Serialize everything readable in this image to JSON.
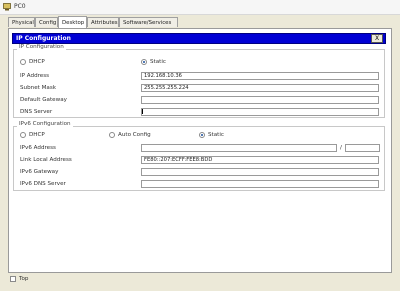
{
  "window": {
    "title": "PC0"
  },
  "tabs": [
    "Physical",
    "Config",
    "Desktop",
    "Attributes",
    "Software/Services"
  ],
  "ip_config": {
    "title": "IP Configuration",
    "close_label": "X",
    "ipv4": {
      "section_label": "IP Configuration",
      "dhcp_label": "DHCP",
      "static_label": "Static",
      "mode": "Static",
      "ip_address_label": "IP Address",
      "ip_address": "192.168.10.36",
      "subnet_mask_label": "Subnet Mask",
      "subnet_mask": "255.255.255.224",
      "default_gateway_label": "Default Gateway",
      "default_gateway": "",
      "dns_server_label": "DNS Server",
      "dns_server": ""
    },
    "ipv6": {
      "section_label": "IPv6 Configuration",
      "dhcp_label": "DHCP",
      "auto_config_label": "Auto Config",
      "static_label": "Static",
      "mode": "Static",
      "address_label": "IPv6 Address",
      "address": "",
      "prefix_separator": "/",
      "prefix": "",
      "link_local_label": "Link Local Address",
      "link_local": "FE80::207:ECFF:FEE8:BDD",
      "gateway_label": "IPv6 Gateway",
      "gateway": "",
      "dns_label": "IPv6 DNS Server",
      "dns": ""
    }
  },
  "footer": {
    "top_label": "Top",
    "top_checked": false
  }
}
